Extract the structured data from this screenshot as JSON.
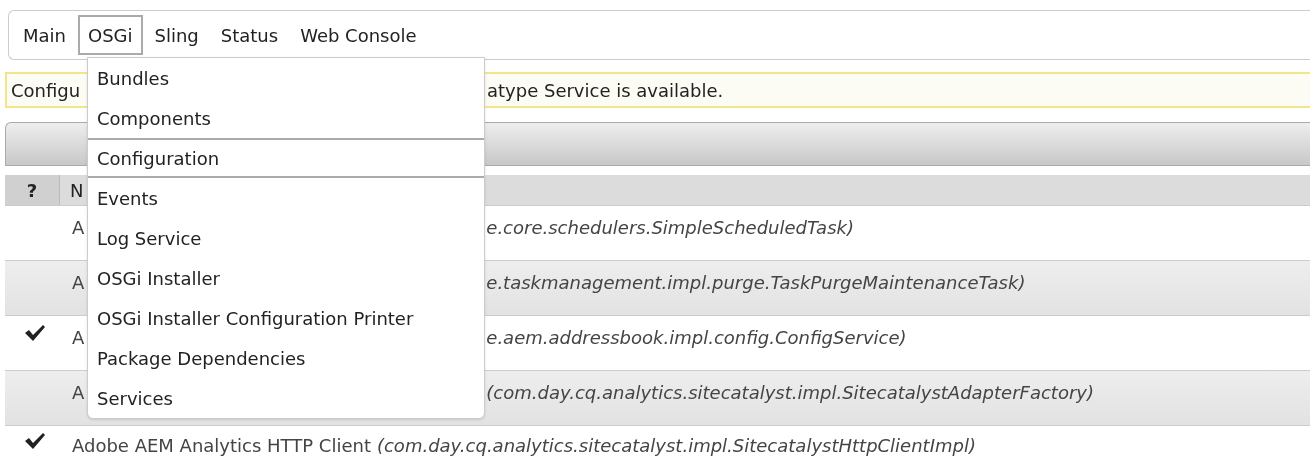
{
  "tabs": [
    {
      "label": "Main",
      "selected": false
    },
    {
      "label": "OSGi",
      "selected": true
    },
    {
      "label": "Sling",
      "selected": false
    },
    {
      "label": "Status",
      "selected": false
    },
    {
      "label": "Web Console",
      "selected": false
    }
  ],
  "menu": {
    "items": [
      {
        "label": "Bundles",
        "selected": false
      },
      {
        "label": "Components",
        "selected": false
      },
      {
        "label": "Configuration",
        "selected": true
      },
      {
        "label": "Events",
        "selected": false
      },
      {
        "label": "Log Service",
        "selected": false
      },
      {
        "label": "OSGi Installer",
        "selected": false
      },
      {
        "label": "OSGi Installer Configuration Printer",
        "selected": false
      },
      {
        "label": "Package Dependencies",
        "selected": false
      },
      {
        "label": "Services",
        "selected": false
      }
    ]
  },
  "notice": {
    "texts": [
      "Configu",
      "atype Service is available."
    ]
  },
  "table": {
    "columns": [
      "?",
      "N"
    ],
    "rows": [
      {
        "kind": "partial",
        "checked": false,
        "name": "A",
        "pid": "e.core.schedulers.SimpleScheduledTask)"
      },
      {
        "kind": "partial",
        "checked": false,
        "name": "A",
        "pid": "e.taskmanagement.impl.purge.TaskPurgeMaintenanceTask)"
      },
      {
        "kind": "partial",
        "checked": true,
        "name": "A",
        "pid": "e.aem.addressbook.impl.config.ConfigService)"
      },
      {
        "kind": "partial",
        "checked": false,
        "name": "A",
        "pid": "(com.day.cq.analytics.sitecatalyst.impl.SitecatalystAdapterFactory)"
      },
      {
        "kind": "full",
        "checked": true,
        "name": "Adobe AEM Analytics HTTP Client",
        "pid": "(com.day.cq.analytics.sitecatalyst.impl.SitecatalystHttpClientImpl)"
      }
    ]
  }
}
